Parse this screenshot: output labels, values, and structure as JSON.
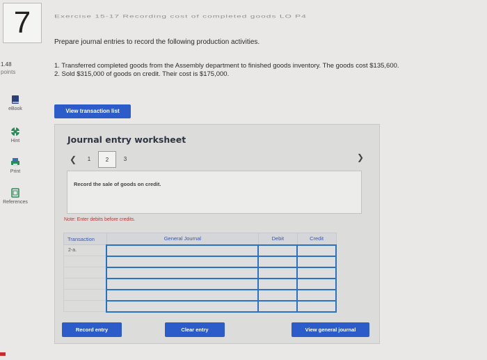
{
  "question": {
    "number": "7",
    "title": "Exercise 15-17 Recording cost of completed goods LO P4"
  },
  "instruction": "Prepare journal entries to record the following production activities.",
  "points": {
    "value": "1.48",
    "label": "points"
  },
  "problem": {
    "lines": [
      "1. Transferred completed goods from the Assembly department to finished goods inventory. The goods cost $135,600.",
      "2. Sold $315,000 of goods on credit. Their cost is $175,000."
    ]
  },
  "sidebar": {
    "items": [
      {
        "label": "eBook",
        "icon": "book-icon"
      },
      {
        "label": "Hint",
        "icon": "lifebuoy-icon"
      },
      {
        "label": "Print",
        "icon": "printer-icon"
      },
      {
        "label": "References",
        "icon": "references-icon"
      }
    ]
  },
  "view_transaction_list": "View transaction list",
  "worksheet": {
    "title": "Journal entry worksheet",
    "pages": [
      "1",
      "2",
      "3"
    ],
    "active_page": "2",
    "description": "Record the sale of goods on credit.",
    "note": "Note: Enter debits before credits.",
    "columns": [
      "Transaction",
      "General Journal",
      "Debit",
      "Credit"
    ],
    "rows": [
      {
        "transaction": "2-a."
      },
      {
        "transaction": ""
      },
      {
        "transaction": ""
      },
      {
        "transaction": ""
      },
      {
        "transaction": ""
      },
      {
        "transaction": ""
      }
    ],
    "buttons": {
      "record": "Record entry",
      "clear": "Clear entry",
      "view_journal": "View general journal"
    }
  },
  "colors": {
    "accent": "#2b5cc9",
    "input_border": "#2a72c8"
  }
}
